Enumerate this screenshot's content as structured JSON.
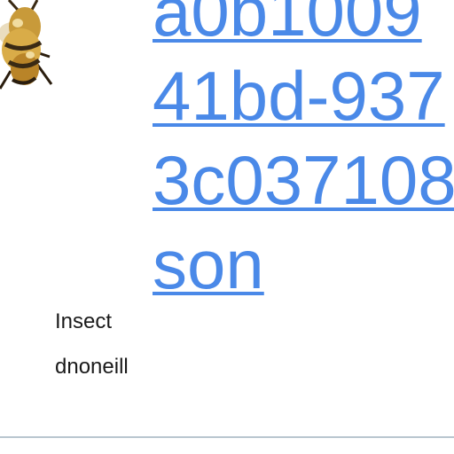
{
  "item": {
    "link_lines": [
      "a0b1009",
      "41bd-937",
      "3c037108",
      "son"
    ],
    "category": "Insect",
    "author": "dnoneill"
  },
  "thumbnail": {
    "icon": "insect-thumbnail",
    "colors": {
      "body": "#c89a3a",
      "dark": "#3a2a14",
      "wing": "#e8d9b8"
    }
  }
}
